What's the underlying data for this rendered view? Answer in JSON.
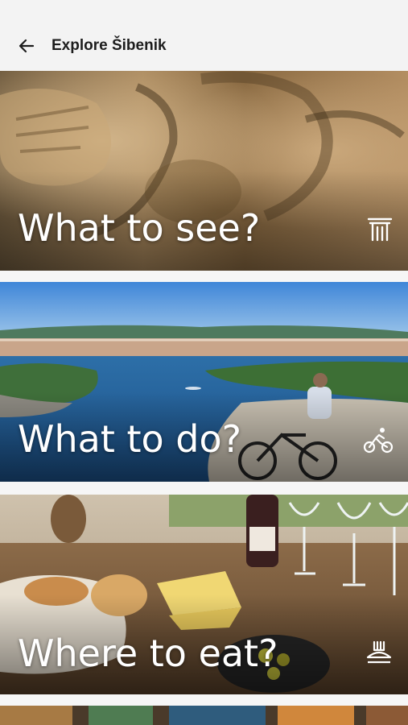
{
  "header": {
    "title": "Explore Šibenik",
    "back_icon": "arrow-left-icon"
  },
  "cards": [
    {
      "label": "What to see?",
      "icon": "monument-column-icon"
    },
    {
      "label": "What to do?",
      "icon": "bicycle-rider-icon"
    },
    {
      "label": "Where to eat?",
      "icon": "food-dish-icon"
    }
  ],
  "colors": {
    "appbar_bg": "#f3f3f3",
    "title_text": "#1d1d1d",
    "card_label": "#ffffff"
  }
}
